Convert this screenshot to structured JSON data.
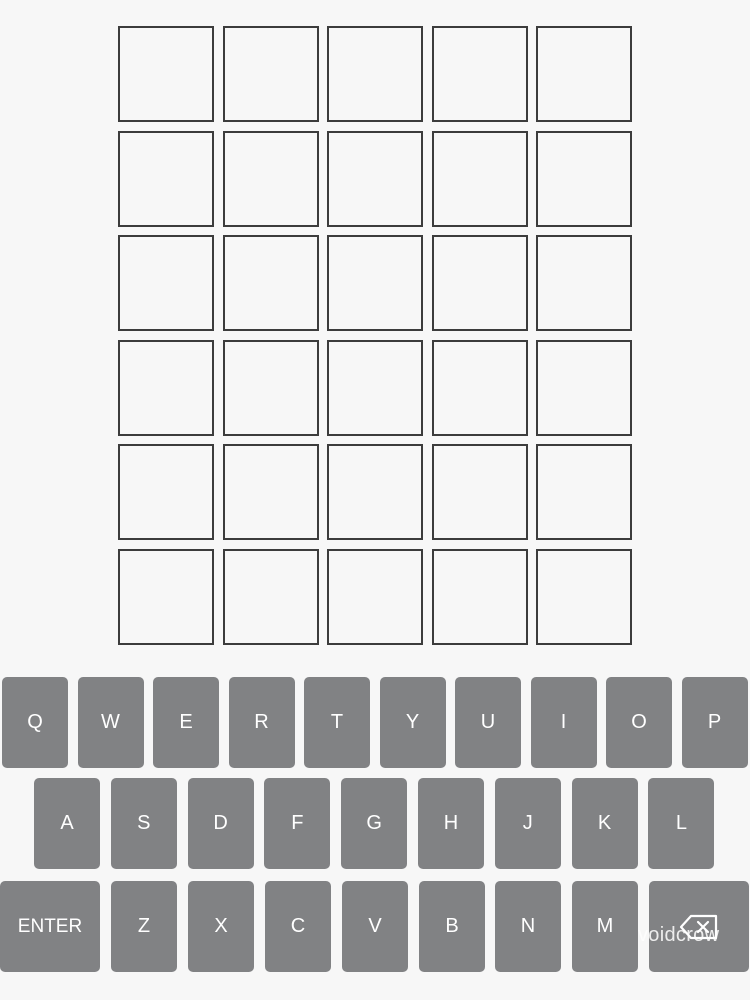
{
  "board": {
    "rows": 6,
    "cols": 5,
    "letters": [
      [
        "",
        "",
        "",
        "",
        ""
      ],
      [
        "",
        "",
        "",
        "",
        ""
      ],
      [
        "",
        "",
        "",
        "",
        ""
      ],
      [
        "",
        "",
        "",
        "",
        ""
      ],
      [
        "",
        "",
        "",
        "",
        ""
      ],
      [
        "",
        "",
        "",
        "",
        ""
      ]
    ]
  },
  "keyboard": {
    "row1": [
      "Q",
      "W",
      "E",
      "R",
      "T",
      "Y",
      "U",
      "I",
      "O",
      "P"
    ],
    "row2": [
      "A",
      "S",
      "D",
      "F",
      "G",
      "H",
      "J",
      "K",
      "L"
    ],
    "row3": [
      "ENTER",
      "Z",
      "X",
      "C",
      "V",
      "B",
      "N",
      "M",
      "BACKSPACE"
    ],
    "backspace_icon": "backspace-icon"
  },
  "watermark": "voidcrow",
  "colors": {
    "background": "#f7f7f7",
    "tile_border": "#3c3c3c",
    "key_background": "#818284",
    "key_text": "#ffffff"
  }
}
